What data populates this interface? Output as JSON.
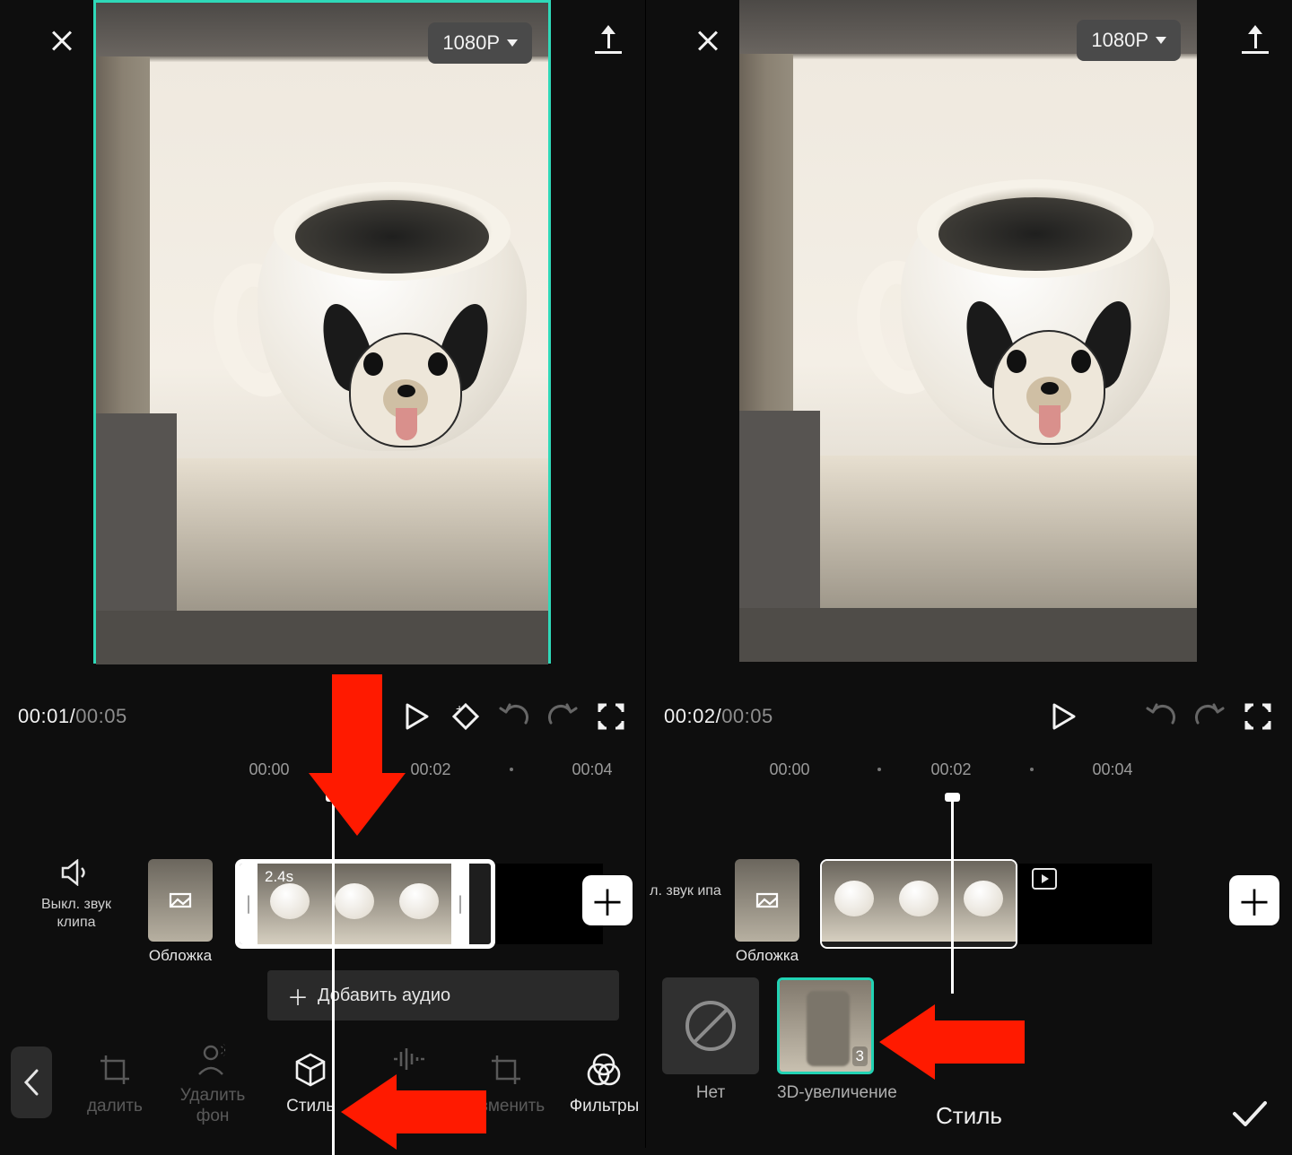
{
  "left": {
    "resolution_label": "1080P",
    "time_current": "00:01",
    "time_duration": "00:05",
    "ruler": [
      "00:00",
      "00:02",
      "00:04"
    ],
    "mute_label": "Выкл. звук клипа",
    "cover_label": "Обложка",
    "clip_duration_tag": "2.4s",
    "add_audio_label": "Добавить аудио",
    "tools": {
      "delete": "далить",
      "remove_bg": "Удалить фон",
      "style": "Стиль",
      "change_audio": "Измен. звук",
      "edit": "Изменить",
      "filters": "Фильтры"
    }
  },
  "right": {
    "resolution_label": "1080P",
    "time_current": "00:02",
    "time_duration": "00:05",
    "ruler": [
      "00:00",
      "00:02",
      "00:04"
    ],
    "mute_label": "л. звук ипа",
    "cover_label": "Обложка",
    "styles": {
      "none_label": "Нет",
      "zoom3d_label": "3D-увеличение",
      "zoom3d_tag": "3"
    },
    "bottom_title": "Стиль"
  }
}
